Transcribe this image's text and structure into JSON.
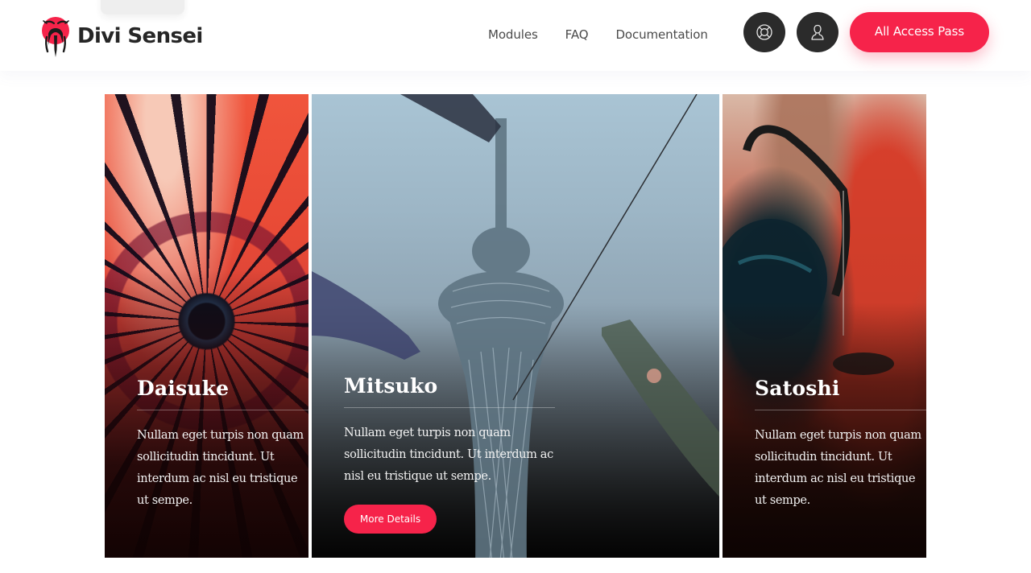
{
  "header": {
    "brand": "Divi Sensei",
    "brand_color": "#f6234a",
    "nav": [
      {
        "label": "Modules"
      },
      {
        "label": "FAQ"
      },
      {
        "label": "Documentation"
      }
    ],
    "icons": {
      "support": "lifebuoy-icon",
      "account": "user-icon"
    },
    "cta_label": "All Access Pass"
  },
  "cards": [
    {
      "name": "Daisuke",
      "description": "Nullam eget turpis non quam sollicitudin tincidunt. Ut interdum ac nisl eu tristique ut sempe.",
      "image": "red-paper-umbrella"
    },
    {
      "name": "Mitsuko",
      "description": "Nullam eget turpis non quam sollicitudin tincidunt. Ut interdum ac nisl eu tristique ut sempe.",
      "image": "tokyo-skytree-koinobori",
      "button_label": "More Details"
    },
    {
      "name": "Satoshi",
      "description": "Nullam eget turpis non quam sollicitudin tincidunt. Ut interdum ac nisl eu tristique ut sempe.",
      "image": "teapot-pouring-tea"
    }
  ],
  "colors": {
    "accent": "#f6234a",
    "dark_button": "#2b2b2b",
    "nav_text": "#4a4a4a"
  }
}
